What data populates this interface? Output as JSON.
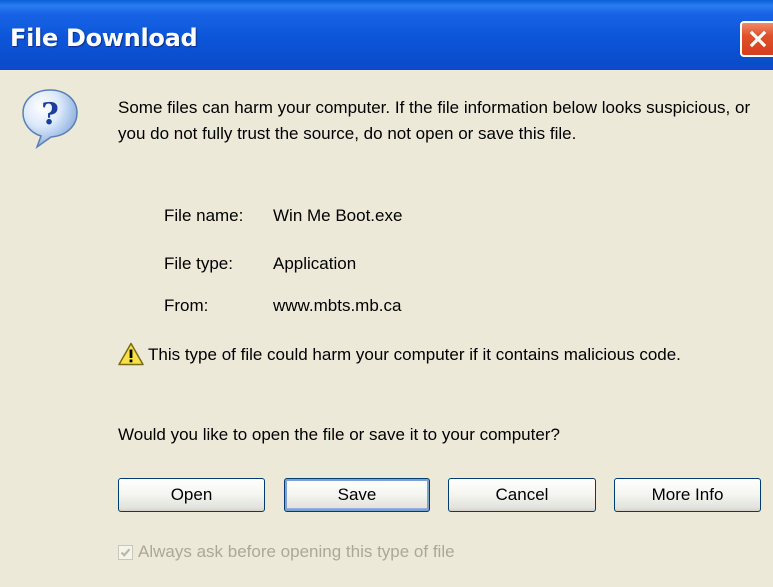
{
  "window": {
    "title": "File Download",
    "close_icon": "close-icon"
  },
  "message": {
    "icon": "help-question-icon",
    "text": "Some files can harm your computer. If the file information below looks suspicious, or you do not fully trust the source, do not open or save this file."
  },
  "file_info": {
    "name_label": "File name:",
    "name_value": "Win Me Boot.exe",
    "type_label": "File type:",
    "type_value": "Application",
    "from_label": "From:",
    "from_value": "www.mbts.mb.ca"
  },
  "caution": {
    "icon": "warning-triangle-icon",
    "text": "This type of file could harm your computer if it contains malicious code."
  },
  "prompt": "Would you like to open the file or save it to your computer?",
  "buttons": {
    "open": "Open",
    "save": "Save",
    "cancel": "Cancel",
    "more_info": "More Info"
  },
  "checkbox": {
    "label": "Always ask before opening this type of file",
    "checked": true,
    "disabled": true
  },
  "colors": {
    "titlebar": "#0b55d9",
    "dialog_bg": "#ece9d8",
    "close_button": "#e0502a",
    "button_border": "#003c74",
    "disabled_text": "#aca899"
  }
}
